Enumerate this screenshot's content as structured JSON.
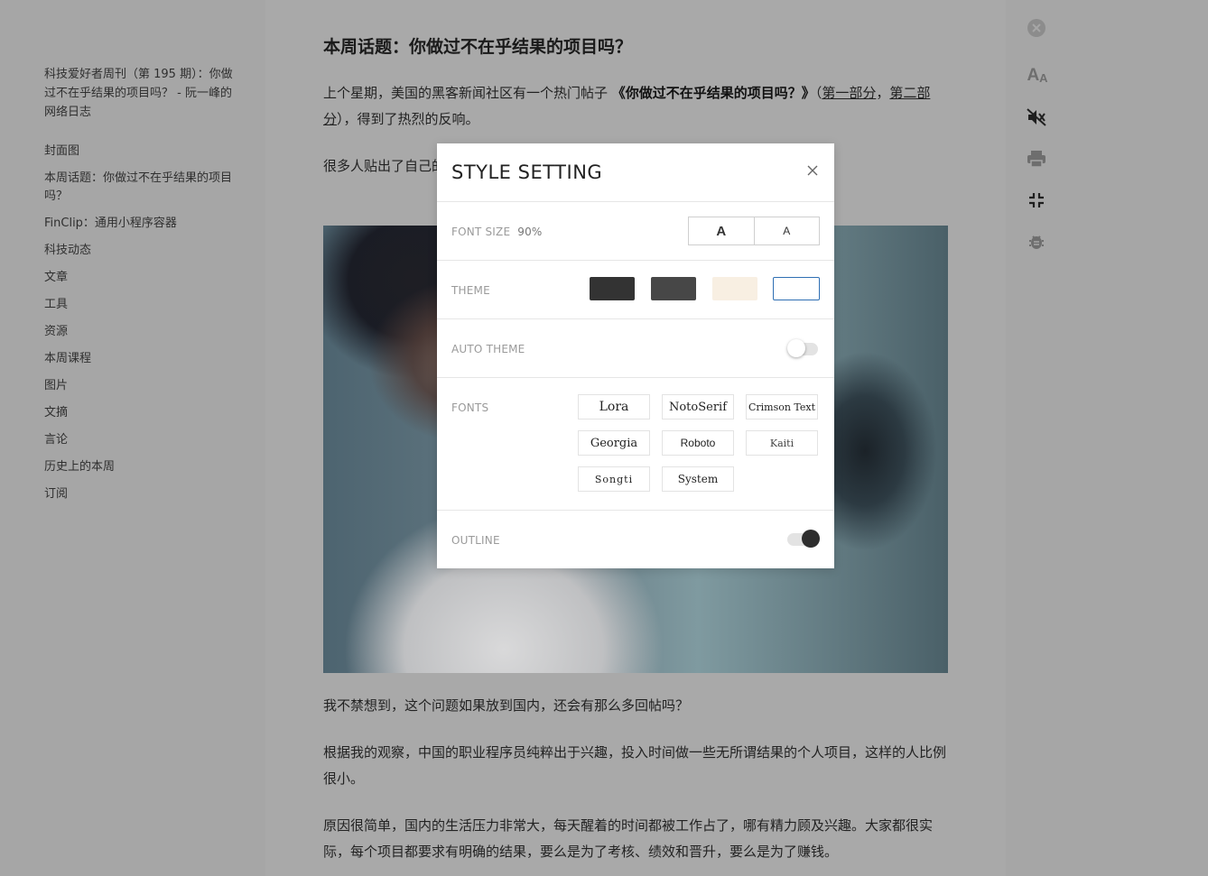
{
  "sidebar": {
    "doc_title": "科技爱好者周刊（第 195 期）：你做过不在乎结果的项目吗？ - 阮一峰的网络日志",
    "toc": [
      "封面图",
      "本周话题：你做过不在乎结果的项目吗？",
      "FinClip：通用小程序容器",
      "科技动态",
      "文章",
      "工具",
      "资源",
      "本周课程",
      "图片",
      "文摘",
      "言论",
      "历史上的本周",
      "订阅"
    ]
  },
  "article": {
    "heading": "本周话题：你做过不在乎结果的项目吗？",
    "p1": {
      "prefix": "上个星期，美国的黑客新闻社区有一个热门帖子",
      "bold": "《你做过不在乎结果的项目吗？》",
      "open_paren": "（",
      "link1": "第一部分",
      "comma": "，",
      "link2": "第二部分",
      "suffix": "），得到了热烈的反响。"
    },
    "p2": "很多人贴出了自己的项目，各种奇奇怪怪的想法都有，五花八门，很多项目很有趣。",
    "p3": "我不禁想到，这个问题如果放到国内，还会有那么多回帖吗？",
    "p4": "根据我的观察，中国的职业程序员纯粹出于兴趣，投入时间做一些无所谓结果的个人项目，这样的人比例很小。",
    "p5": "原因很简单，国内的生活压力非常大，每天醒着的时间都被工作占了，哪有精力顾及兴趣。大家都很实际，每个项目都要求有明确的结果，要么是为了考核、绩效和晋升，要么是为了赚钱。"
  },
  "toolbar": {
    "icons": [
      "close-circle-icon",
      "font-size-icon",
      "mute-icon",
      "print-icon",
      "exit-fullscreen-icon",
      "bug-icon"
    ],
    "font_icon_text": "A",
    "font_icon_small": "A"
  },
  "modal": {
    "title": "STYLE SETTING",
    "font_size_label": "FONT SIZE",
    "font_size_value": "90%",
    "increase_label": "A",
    "decrease_label": "A",
    "theme_label": "THEME",
    "themes": [
      {
        "name": "dark",
        "color": "#333333"
      },
      {
        "name": "dim",
        "color": "#474747"
      },
      {
        "name": "sepia",
        "color": "#f8efe2"
      },
      {
        "name": "light",
        "color": "#ffffff",
        "selected": true
      }
    ],
    "auto_theme_label": "AUTO THEME",
    "auto_theme_on": false,
    "fonts_label": "FONTS",
    "fonts": [
      "Lora",
      "NotoSerif",
      "Crimson Text",
      "Georgia",
      "Roboto",
      "Kaiti",
      "Songti",
      "System"
    ],
    "outline_label": "OUTLINE",
    "outline_on": true,
    "accent_color": "#2f6fb3"
  }
}
